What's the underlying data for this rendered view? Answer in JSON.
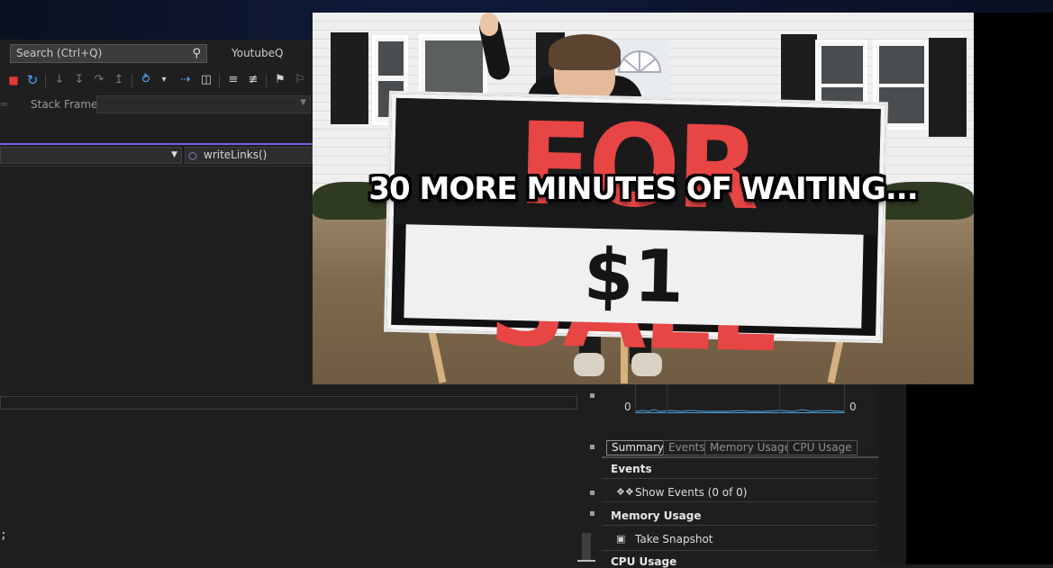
{
  "ide": {
    "search": {
      "placeholder": "Search (Ctrl+Q)"
    },
    "solution_name": "YoutubeQ",
    "debug_location": {
      "stack_frame_label": "Stack Frame:"
    },
    "navigation": {
      "member": "writeLinks()"
    },
    "editor": {
      "visible_code": ";"
    },
    "colors": {
      "accent": "#7160e8",
      "stop": "#e53935",
      "restart": "#4fa3f7"
    }
  },
  "diagnostics": {
    "graph": {
      "left_axis_value": "0",
      "right_axis_value": "0"
    },
    "tabs": [
      {
        "label": "Summary",
        "active": true
      },
      {
        "label": "Events",
        "active": false
      },
      {
        "label": "Memory Usage",
        "active": false
      },
      {
        "label": "CPU Usage",
        "active": false
      }
    ],
    "sections": {
      "events": {
        "heading": "Events",
        "action": "Show Events (0 of 0)"
      },
      "memory": {
        "heading": "Memory Usage",
        "action": "Take Snapshot"
      },
      "cpu": {
        "heading": "CPU Usage"
      }
    }
  },
  "video": {
    "caption": "30 MORE MINUTES OF WAITING...",
    "sign_top": "FOR SALE",
    "sign_price": "$1"
  }
}
